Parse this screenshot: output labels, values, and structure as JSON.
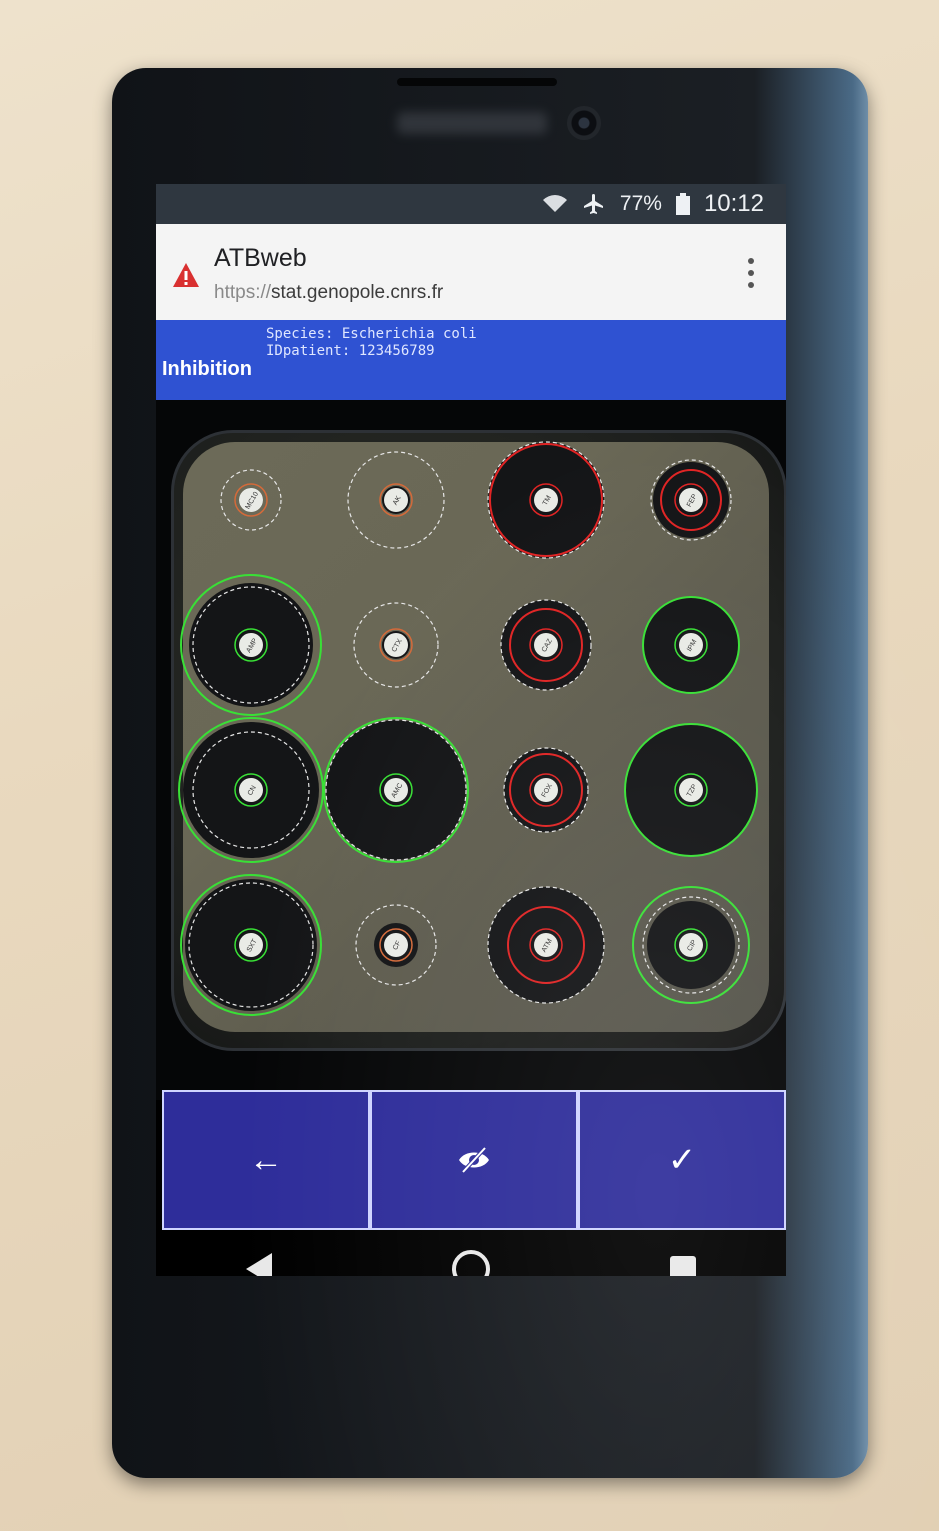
{
  "status_bar": {
    "battery": "77%",
    "time": "10:12",
    "icons": [
      "wifi-icon",
      "airplane-mode-icon",
      "battery-icon"
    ]
  },
  "browser": {
    "page_title": "ATBweb",
    "url_protocol": "https://",
    "url_host": "stat.genopole.cnrs.fr",
    "security_icon": "warning-icon"
  },
  "info_bar": {
    "species_line": "Species: Escherichia coli",
    "patient_line": "IDpatient: 123456789",
    "mode_label": "Inhibition",
    "background": "#2f52d2"
  },
  "plate": {
    "disks": [
      {
        "row": 1,
        "col": 1,
        "status": "neutral",
        "label": "MC10"
      },
      {
        "row": 1,
        "col": 2,
        "status": "neutral",
        "label": "AK"
      },
      {
        "row": 1,
        "col": 3,
        "status": "red",
        "label": "TM"
      },
      {
        "row": 1,
        "col": 4,
        "status": "red",
        "label": "FEP"
      },
      {
        "row": 2,
        "col": 1,
        "status": "green",
        "label": "AMP"
      },
      {
        "row": 2,
        "col": 2,
        "status": "neutral",
        "label": "CTX"
      },
      {
        "row": 2,
        "col": 3,
        "status": "red",
        "label": "CAZ"
      },
      {
        "row": 2,
        "col": 4,
        "status": "green",
        "label": "IPM"
      },
      {
        "row": 3,
        "col": 1,
        "status": "green",
        "label": "CN"
      },
      {
        "row": 3,
        "col": 2,
        "status": "green",
        "label": "AMC"
      },
      {
        "row": 3,
        "col": 3,
        "status": "red",
        "label": "FOX"
      },
      {
        "row": 3,
        "col": 4,
        "status": "green",
        "label": "TZP"
      },
      {
        "row": 4,
        "col": 1,
        "status": "green",
        "label": "SXT"
      },
      {
        "row": 4,
        "col": 2,
        "status": "neutral",
        "label": "CF"
      },
      {
        "row": 4,
        "col": 3,
        "status": "red",
        "label": "ATM"
      },
      {
        "row": 4,
        "col": 4,
        "status": "green",
        "label": "CIP"
      }
    ],
    "colors": {
      "green": "#39e036",
      "red": "#e02424",
      "dashed": "#e6e6e6"
    }
  },
  "action_buttons": [
    {
      "icon": "arrow-left-icon",
      "glyph": "←"
    },
    {
      "icon": "eye-off-icon",
      "glyph": ""
    },
    {
      "icon": "checkmark-icon",
      "glyph": "✓"
    }
  ],
  "nav_bar": [
    "back-icon",
    "home-icon",
    "recents-icon"
  ]
}
